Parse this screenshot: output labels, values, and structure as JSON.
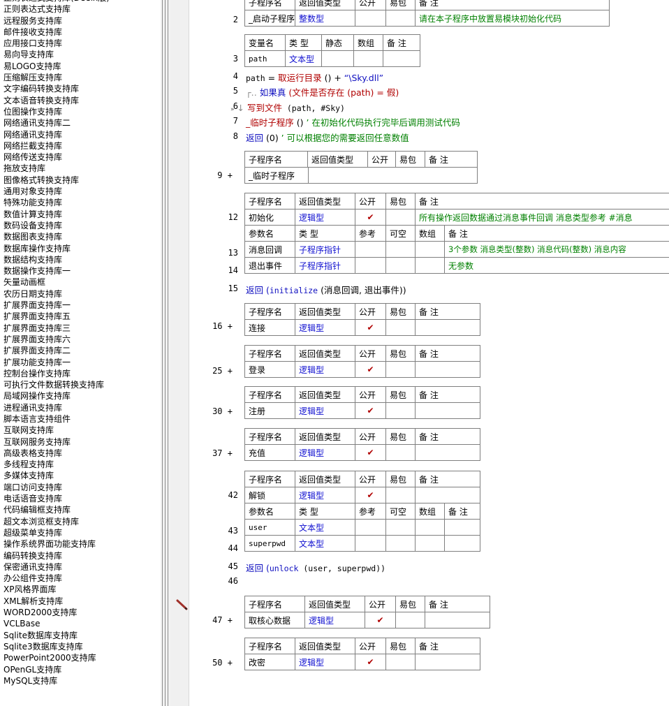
{
  "sidebar": {
    "items": [
      "正则表达式支持库(Deelx版)",
      "正则表达式支持库",
      "远程服务支持库",
      "邮件接收支持库",
      "应用接口支持库",
      "易向导支持库",
      "易LOGO支持库",
      "压缩解压支持库",
      "文字编码转换支持库",
      "文本语音转换支持库",
      "位图操作支持库",
      "网络通讯支持库二",
      "网络通讯支持库",
      "网络拦截支持库",
      "网络传送支持库",
      "拖放支持库",
      "图像格式转换支持库",
      "通用对象支持库",
      "特殊功能支持库",
      "数值计算支持库",
      "数码设备支持库",
      "数据图表支持库",
      "数据库操作支持库",
      "数据结构支持库",
      "数据操作支持库一",
      "矢量动画框",
      "农历日期支持库",
      "扩展界面支持库一",
      "扩展界面支持库五",
      "扩展界面支持库三",
      "扩展界面支持库六",
      "扩展界面支持库二",
      "扩展功能支持库一",
      "控制台操作支持库",
      "可执行文件数据转换支持库",
      "局域网操作支持库",
      "进程通讯支持库",
      "脚本语言支持组件",
      "互联网支持库",
      "互联网服务支持库",
      "高级表格支持库",
      "多线程支持库",
      "多媒体支持库",
      "端口访问支持库",
      "电话语音支持库",
      "代码编辑框支持库",
      "超文本浏览框支持库",
      "超级菜单支持库",
      "操作系统界面功能支持库",
      "编码转换支持库",
      "保密通讯支持库",
      "办公组件支持库",
      "XP风格界面库",
      "XML解析支持库",
      "WORD2000支持库",
      "VCLBase",
      "Sqlite数据库支持库",
      "Sqlite3数据库支持库",
      "PowerPoint2000支持库",
      "OPenGL支持库",
      "MySQL支持库"
    ]
  },
  "colors": {
    "keyword": "#1010d0",
    "comment": "#008000",
    "function": "#b00000"
  },
  "headers": {
    "sub": [
      "子程序名",
      "返回值类型",
      "公开",
      "易包",
      "备 注"
    ],
    "var": [
      "变量名",
      "类 型",
      "静态",
      "数组",
      "备 注"
    ],
    "param": [
      "参数名",
      "类 型",
      "参考",
      "可空",
      "数组",
      "备 注"
    ]
  },
  "check": "✔",
  "lines": {
    "l2": "2",
    "l3": "3",
    "l4": "4",
    "l5": "5",
    "l6": "6",
    "l7": "7",
    "l8": "8",
    "l9": "9",
    "l12": "12",
    "l13": "13",
    "l14": "14",
    "l15": "15",
    "l16": "16",
    "l25": "25",
    "l30": "30",
    "l37": "37",
    "l42": "42",
    "l43": "43",
    "l44": "44",
    "l45": "45",
    "l46": "46",
    "l47": "47",
    "l50": "50",
    "plus": "+"
  },
  "startup": {
    "name": "_启动子程序",
    "type": "整数型",
    "note": "请在本子程序中放置易模块初始化代码"
  },
  "var_path": {
    "name": "path",
    "type": "文本型"
  },
  "code": {
    "l4_a": "path",
    "l4_b": " = ",
    "l4_fn": "取运行目录",
    "l4_c": " () + ",
    "l4_str": "“\\Sky.dll”",
    "l5_kw": "如果真",
    "l5_a": " (",
    "l5_fn": "文件是否存在",
    "l5_b": " (path) = ",
    "l5_c": "假",
    "l5_d": ")",
    "l6_fn": "写到文件",
    "l6_a": " (path, #Sky)",
    "l7_fn": "_临时子程序",
    "l7_a": " () ",
    "l7_cmt": "’ 在初始化代码执行完毕后调用测试代码",
    "l8_kw": "返回",
    "l8_a": " (0) ",
    "l8_cmt": "’ 可以根据您的需要返回任意数值",
    "l15_kw": "返回",
    "l15_a": " (",
    "l15_b": "initialize",
    "l15_c": " (消息回调, 退出事件))",
    "l45_kw": "返回",
    "l45_a": " (",
    "l45_b": "unlock",
    "l45_c": " (user, superpwd))"
  },
  "temp": {
    "name": "_临时子程序"
  },
  "init": {
    "name": "初始化",
    "type": "逻辑型",
    "note": "所有操作返回数据通过消息事件回调 消息类型参考 #消息",
    "p1": {
      "name": "消息回调",
      "type": "子程序指针",
      "note": "3个参数 消息类型(整数) 消息代码(整数) 消息内容"
    },
    "p2": {
      "name": "退出事件",
      "type": "子程序指针",
      "note": "无参数"
    }
  },
  "connect": {
    "name": "连接",
    "type": "逻辑型"
  },
  "login": {
    "name": "登录",
    "type": "逻辑型"
  },
  "register": {
    "name": "注册",
    "type": "逻辑型"
  },
  "recharge": {
    "name": "充值",
    "type": "逻辑型"
  },
  "unlock": {
    "name": "解锁",
    "type": "逻辑型",
    "p1": {
      "name": "user",
      "type": "文本型"
    },
    "p2": {
      "name": "superpwd",
      "type": "文本型"
    }
  },
  "coredata": {
    "name": "取核心数据",
    "type": "逻辑型"
  },
  "changepwd": {
    "name": "改密",
    "type": "逻辑型"
  }
}
